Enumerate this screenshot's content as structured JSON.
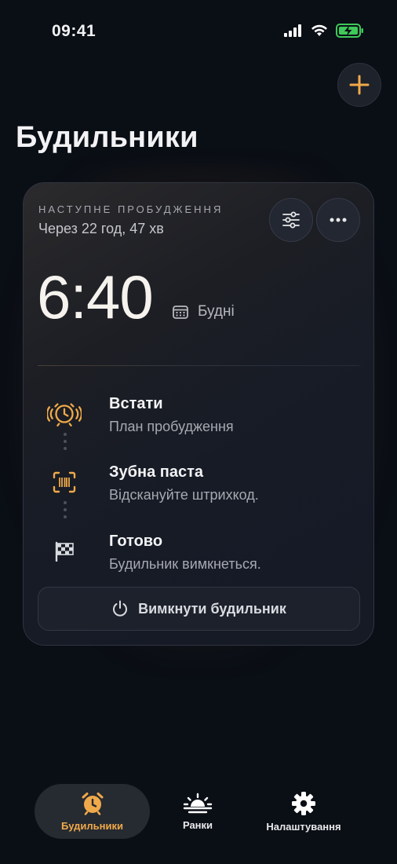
{
  "status": {
    "time": "09:41"
  },
  "page": {
    "title": "Будильники"
  },
  "alarm": {
    "next_label": "НАСТУПНЕ ПРОБУДЖЕННЯ",
    "countdown": "Через 22 год, 47 хв",
    "time": "6:40",
    "repeat": "Будні",
    "steps": [
      {
        "title": "Встати",
        "subtitle": "План пробудження",
        "icon": "alarm-ringing-icon"
      },
      {
        "title": "Зубна паста",
        "subtitle": "Відскануйте штрихкод.",
        "icon": "barcode-scan-icon"
      },
      {
        "title": "Готово",
        "subtitle": "Будильник вимкнеться.",
        "icon": "checkered-flag-icon"
      }
    ],
    "off_button": "Вимкнути будильник"
  },
  "tabs": [
    {
      "label": "Будильники",
      "icon": "alarm-clock-icon",
      "active": true
    },
    {
      "label": "Ранки",
      "icon": "sunrise-icon",
      "active": false
    },
    {
      "label": "Налаштування",
      "icon": "gear-icon",
      "active": false
    }
  ],
  "colors": {
    "accent": "#f0a94a",
    "background": "#0a0e15",
    "card": "#181c25",
    "battery": "#3ec95a"
  }
}
